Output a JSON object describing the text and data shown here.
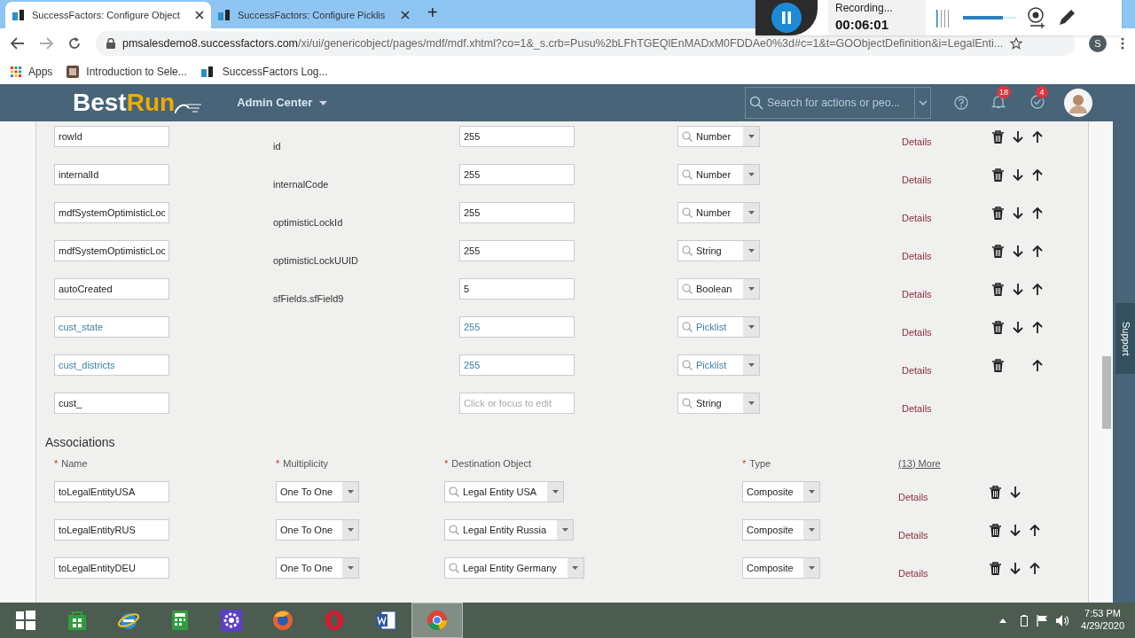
{
  "browser": {
    "tabs": [
      {
        "title": "SuccessFactors: Configure Object",
        "selected": true
      },
      {
        "title": "SuccessFactors: Configure Picklis",
        "selected": false
      }
    ],
    "new_tab": "+",
    "url_host": "pmsalesdemo8.successfactors.com",
    "url_path": "/xi/ui/genericobject/pages/mdf/mdf.xhtml?co=1&_s.crb=Pusu%2bLFhTGEQlEnMADxM0FDDAe0%3d#c=1&t=GOObjectDefinition&i=LegalEnti...",
    "profile": "S",
    "bookmarks": [
      {
        "kind": "apps",
        "label": "Apps"
      },
      {
        "kind": "page",
        "label": "Introduction to Sele..."
      },
      {
        "kind": "sf",
        "label": "SuccessFactors Log..."
      }
    ]
  },
  "recorder": {
    "status": "Recording...",
    "time": "00:06:01",
    "volume": {
      "level": 0.75
    }
  },
  "header": {
    "logo_a": "Best",
    "logo_b": "Run",
    "menu": "Admin Center",
    "search_placeholder": "Search for actions or peo...",
    "notifications": "18",
    "approvals": "4"
  },
  "fields": [
    {
      "name": "rowId",
      "db_field": "id",
      "length": "255",
      "type": "Number",
      "details": "Details",
      "custom": false,
      "deletable": true,
      "down": true,
      "up": true
    },
    {
      "name": "internalId",
      "db_field": "internalCode",
      "length": "255",
      "type": "Number",
      "details": "Details",
      "custom": false,
      "deletable": true,
      "down": true,
      "up": true
    },
    {
      "name": "mdfSystemOptimisticLoc",
      "db_field": "optimisticLockId",
      "length": "255",
      "type": "Number",
      "details": "Details",
      "custom": false,
      "deletable": true,
      "down": true,
      "up": true
    },
    {
      "name": "mdfSystemOptimisticLoc",
      "db_field": "optimisticLockUUID",
      "length": "255",
      "type": "String",
      "details": "Details",
      "custom": false,
      "deletable": true,
      "down": true,
      "up": true
    },
    {
      "name": "autoCreated",
      "db_field": "sfFields.sfField9",
      "length": "5",
      "type": "Boolean",
      "details": "Details",
      "custom": false,
      "deletable": true,
      "down": true,
      "up": true
    },
    {
      "name": "cust_state",
      "length": "255",
      "type": "Picklist",
      "details": "Details",
      "custom": true,
      "deletable": true,
      "down": true,
      "up": true
    },
    {
      "name": "cust_districts",
      "length": "255",
      "type": "Picklist",
      "details": "Details",
      "custom": true,
      "deletable": true,
      "down": false,
      "up": true
    },
    {
      "name": "cust_",
      "length_placeholder": "Click or focus to edit",
      "type": "String",
      "details": "Details",
      "custom": false,
      "deletable": false,
      "down": false,
      "up": false
    }
  ],
  "support": "Support",
  "associations": {
    "title": "Associations",
    "columns": [
      {
        "mark": "*",
        "label": "Name"
      },
      {
        "mark": "*",
        "label": "Multiplicity"
      },
      {
        "mark": "*",
        "label": "Destination Object"
      },
      {
        "mark": "*",
        "label": "Type"
      }
    ],
    "more": "(13) More",
    "rows": [
      {
        "name": "toLegalEntityUSA",
        "multiplicity": "One To One",
        "destination": "Legal Entity USA",
        "type": "Composite",
        "details": "Details",
        "down": true,
        "up": false
      },
      {
        "name": "toLegalEntityRUS",
        "multiplicity": "One To One",
        "destination": "Legal Entity Russia",
        "type": "Composite",
        "details": "Details",
        "down": true,
        "up": true
      },
      {
        "name": "toLegalEntityDEU",
        "multiplicity": "One To One",
        "destination": "Legal Entity Germany",
        "type": "Composite",
        "details": "Details",
        "down": true,
        "up": true
      }
    ]
  },
  "taskbar": {
    "apps": [
      {
        "kind": "start",
        "selected": false
      },
      {
        "kind": "store",
        "selected": false
      },
      {
        "kind": "ie",
        "selected": false
      },
      {
        "kind": "calculator",
        "selected": false
      },
      {
        "kind": "settings",
        "selected": false
      },
      {
        "kind": "firefox",
        "selected": false
      },
      {
        "kind": "opera",
        "selected": false
      },
      {
        "kind": "word",
        "selected": false
      },
      {
        "kind": "chrome",
        "selected": true
      }
    ],
    "time": "7:53 PM",
    "date": "4/29/2020"
  }
}
